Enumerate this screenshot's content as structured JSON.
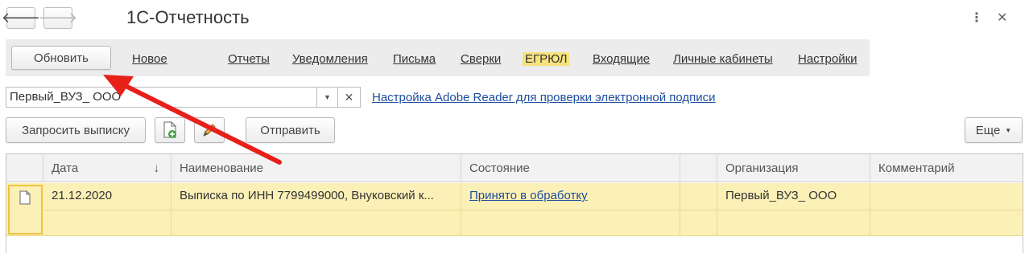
{
  "window": {
    "title": "1С-Отчетность",
    "back_icon": "arrow-left",
    "forward_icon": "arrow-right",
    "menu_icon": "more-vertical",
    "close_icon": "close"
  },
  "toolbar": {
    "refresh_label": "Обновить",
    "tabs": [
      {
        "label": "Новое"
      },
      {
        "label": "Отчеты"
      },
      {
        "label": "Уведомления"
      },
      {
        "label": "Письма"
      },
      {
        "label": "Сверки"
      },
      {
        "label": "ЕГРЮЛ",
        "active": true
      },
      {
        "label": "Входящие"
      },
      {
        "label": "Личные кабинеты"
      },
      {
        "label": "Настройки"
      }
    ],
    "active_color": "#f7e27d"
  },
  "organization": {
    "value": "Первый_ВУЗ_ ООО",
    "adobe_link": "Настройка Adobe Reader для проверки электронной подписи"
  },
  "actions": {
    "request_label": "Запросить выписку",
    "send_label": "Отправить",
    "more_label": "Еще"
  },
  "table": {
    "columns": [
      "Дата",
      "Наименование",
      "Состояние",
      "Организация",
      "Комментарий"
    ],
    "sort_icon": "↓",
    "rows": [
      {
        "date": "21.12.2020",
        "name": "Выписка по ИНН 7799499000, Внуковский к...",
        "status": "Принято в обработку",
        "org": "Первый_ВУЗ_ ООО",
        "comment": ""
      }
    ]
  },
  "annotation": {
    "color": "#e8201a"
  }
}
